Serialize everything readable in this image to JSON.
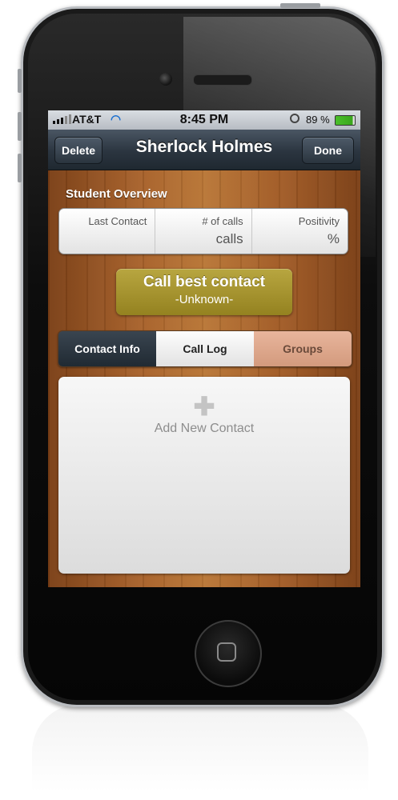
{
  "statusbar": {
    "carrier": "AT&T",
    "time": "8:45 PM",
    "battery": "89 %",
    "icons": [
      "signal-bars-icon",
      "wifi-icon",
      "orientation-lock-icon",
      "battery-icon"
    ]
  },
  "navbar": {
    "left_button": "Delete",
    "title": "Sherlock Holmes",
    "right_button": "Done"
  },
  "overview": {
    "title": "Student Overview",
    "columns": [
      {
        "label": "Last Contact",
        "value": ""
      },
      {
        "label": "# of calls",
        "value": "calls"
      },
      {
        "label": "Positivity",
        "value": "%"
      }
    ]
  },
  "call_best": {
    "label": "Call best contact",
    "subtitle": "-Unknown-",
    "color": "#a8962f"
  },
  "tabs": [
    {
      "label": "Contact Info",
      "selected": true
    },
    {
      "label": "Call Log",
      "selected": false
    },
    {
      "label": "Groups",
      "selected": false
    }
  ],
  "contact_panel": {
    "add_label": "Add New Contact",
    "icon": "plus-icon"
  },
  "colors": {
    "wood": "#a8622b",
    "navbar": "#2b3540"
  }
}
